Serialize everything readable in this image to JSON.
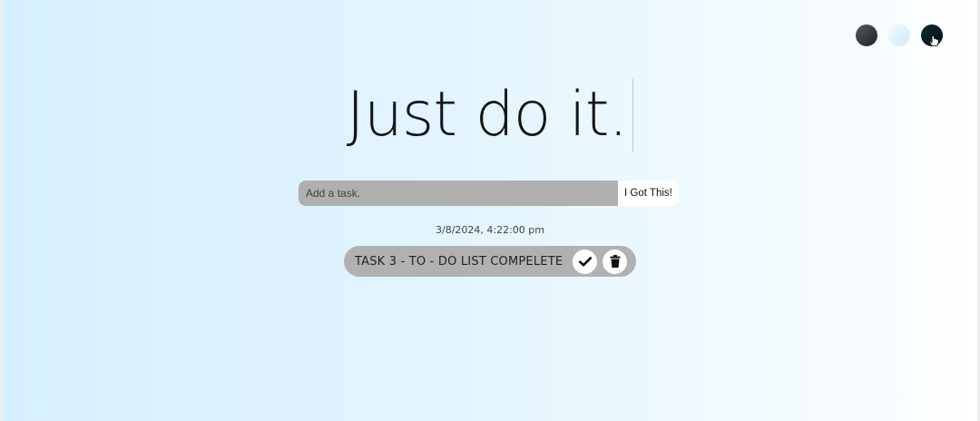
{
  "theme_switcher": {
    "options": [
      {
        "name": "standard",
        "color": "#2b3338"
      },
      {
        "name": "light",
        "color": "#e2f3fd"
      },
      {
        "name": "darker",
        "color": "#08161c"
      }
    ],
    "cursor_icon": "hand-pointer-icon"
  },
  "title": "Just do it.",
  "form": {
    "input_placeholder": "Add a task.",
    "input_value": "",
    "submit_label": "I Got This!"
  },
  "datetime": "3/8/2024, 4:22:00 pm",
  "todos": [
    {
      "text": "TASK 3 - TO - DO LIST COMPELETE",
      "check_icon": "check-icon",
      "delete_icon": "trash-icon"
    }
  ],
  "colors": {
    "background_start": "#d6efff",
    "background_end": "#ffffff",
    "input_bg": "#b0b0b0",
    "todo_bg": "#b1b1b1",
    "text": "#151515"
  }
}
